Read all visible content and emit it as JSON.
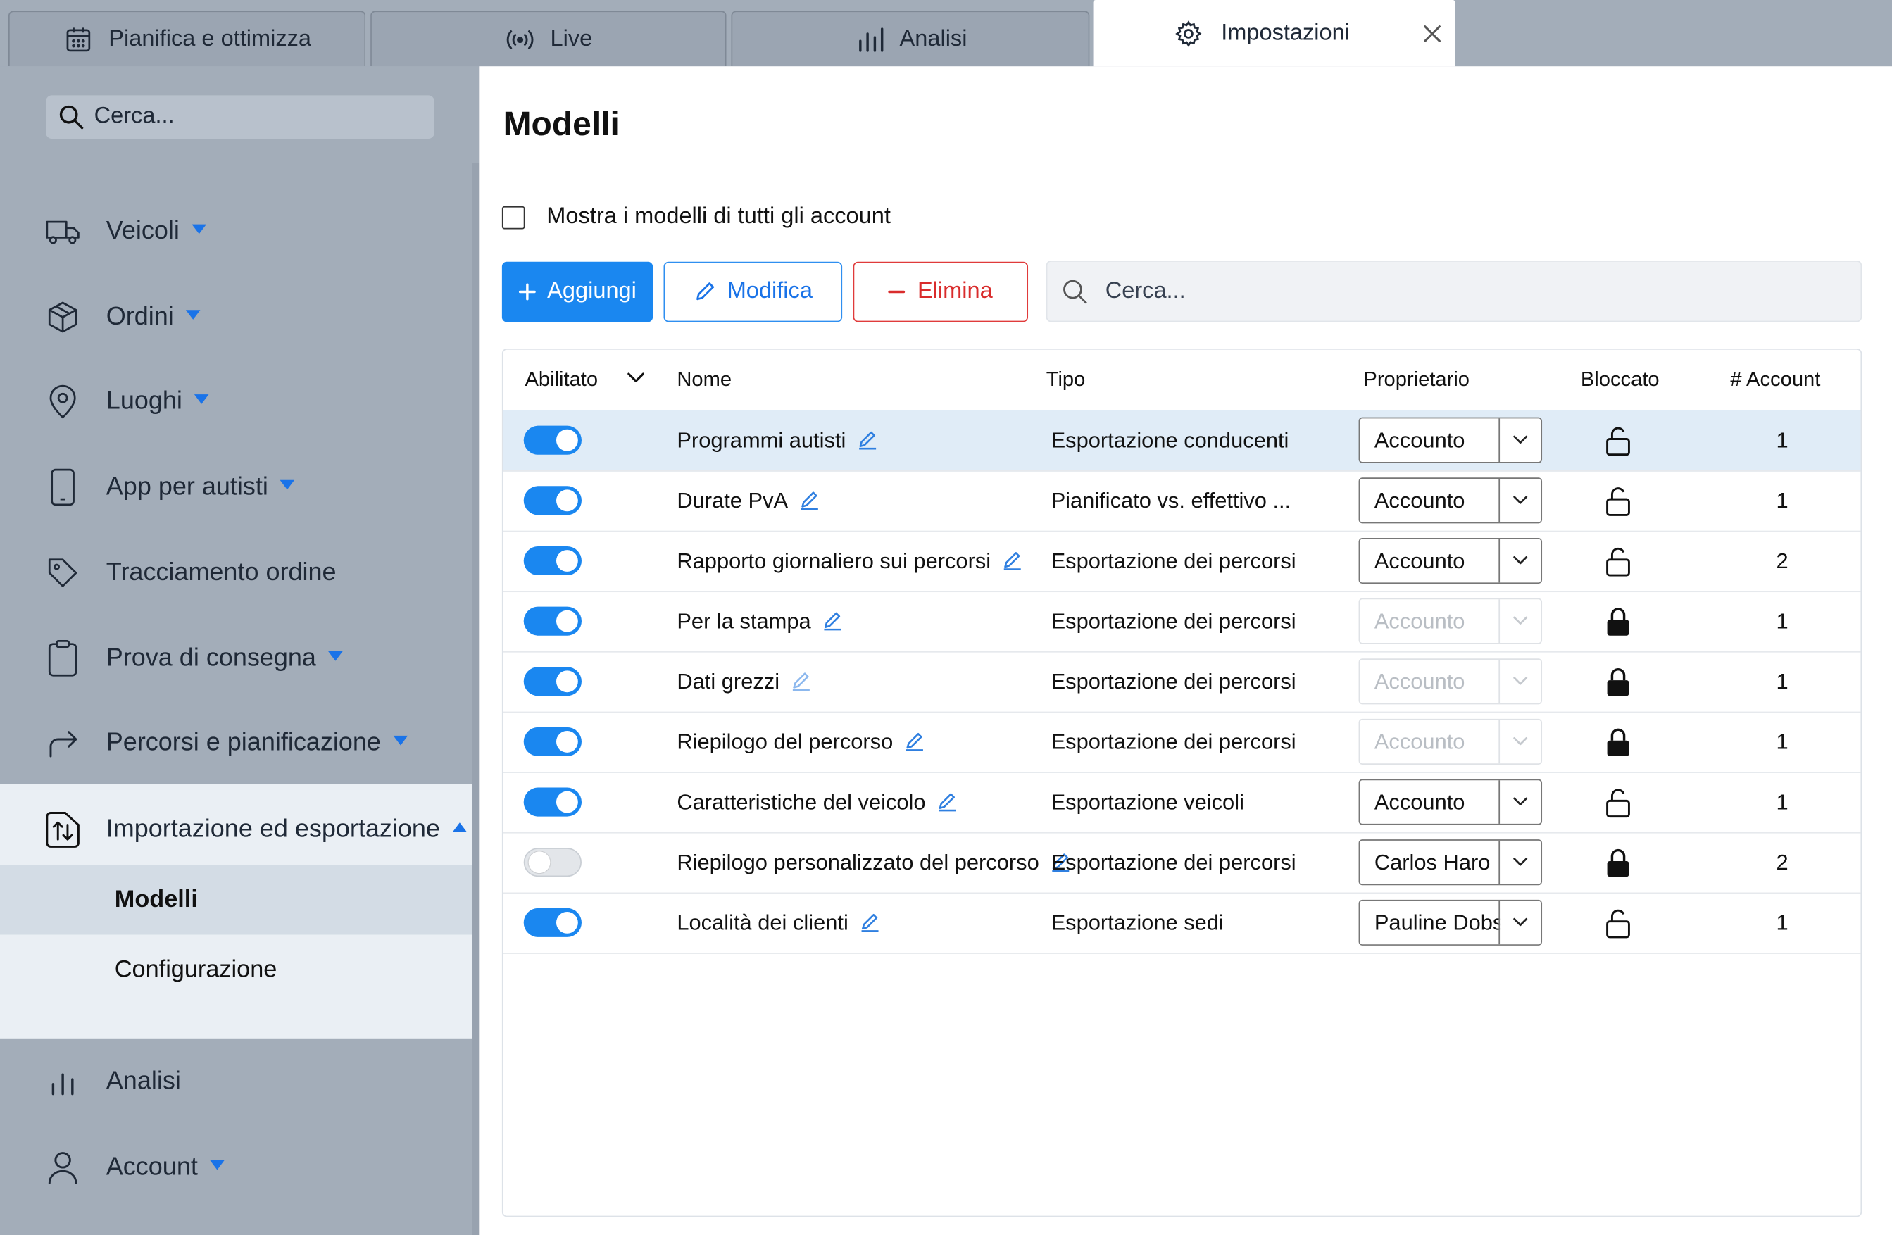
{
  "tabs": [
    {
      "label": "Pianifica e ottimizza",
      "icon": "calendar-icon",
      "active": false
    },
    {
      "label": "Live",
      "icon": "broadcast-icon",
      "active": false
    },
    {
      "label": "Analisi",
      "icon": "bar-chart-icon",
      "active": false
    },
    {
      "label": "Impostazioni",
      "icon": "gear-icon",
      "active": true
    }
  ],
  "sidebar": {
    "search_placeholder": "Cerca...",
    "items": [
      {
        "label": "Veicoli",
        "icon": "truck-icon"
      },
      {
        "label": "Ordini",
        "icon": "package-icon"
      },
      {
        "label": "Luoghi",
        "icon": "map-pin-icon"
      },
      {
        "label": "App per autisti",
        "icon": "phone-icon"
      },
      {
        "label": "Tracciamento ordine",
        "icon": "tag-icon"
      },
      {
        "label": "Prova di consegna",
        "icon": "clipboard-icon"
      },
      {
        "label": "Percorsi e pianificazione",
        "icon": "route-arrow-icon"
      },
      {
        "label": "Importazione ed esportazione",
        "icon": "import-export-icon"
      },
      {
        "label": "Analisi",
        "icon": "bar-chart-icon"
      },
      {
        "label": "Account",
        "icon": "user-icon"
      }
    ],
    "subitems": [
      {
        "label": "Modelli",
        "selected": true
      },
      {
        "label": "Configurazione",
        "selected": false
      }
    ]
  },
  "main": {
    "title": "Modelli",
    "show_all_label": "Mostra i modelli di tutti gli account",
    "buttons": {
      "add": "Aggiungi",
      "edit": "Modifica",
      "delete": "Elimina"
    },
    "search_placeholder": "Cerca...",
    "table": {
      "headers": {
        "enabled": "Abilitato",
        "name": "Nome",
        "type": "Tipo",
        "owner": "Proprietario",
        "locked": "Bloccato",
        "accounts": "# Account"
      },
      "rows": [
        {
          "enabled": true,
          "name": "Programmi autisti",
          "type": "Esportazione conducenti",
          "owner": "Accounto",
          "owner_disabled": false,
          "locked": false,
          "accounts": "1",
          "highlight": true
        },
        {
          "enabled": true,
          "name": "Durate PvA",
          "type": "Pianificato vs. effettivo ...",
          "owner": "Accounto",
          "owner_disabled": false,
          "locked": false,
          "accounts": "1"
        },
        {
          "enabled": true,
          "name": "Rapporto giornaliero sui percorsi",
          "type": "Esportazione dei percorsi",
          "owner": "Accounto",
          "owner_disabled": false,
          "locked": false,
          "accounts": "2"
        },
        {
          "enabled": true,
          "name": "Per la stampa",
          "type": "Esportazione dei percorsi",
          "owner": "Accounto",
          "owner_disabled": true,
          "locked": true,
          "accounts": "1"
        },
        {
          "enabled": true,
          "name": "Dati grezzi",
          "type": "Esportazione dei percorsi",
          "owner": "Accounto",
          "owner_disabled": true,
          "locked": true,
          "accounts": "1"
        },
        {
          "enabled": true,
          "name": "Riepilogo del percorso",
          "type": "Esportazione dei percorsi",
          "owner": "Accounto",
          "owner_disabled": true,
          "locked": true,
          "accounts": "1"
        },
        {
          "enabled": true,
          "name": "Caratteristiche del veicolo",
          "type": "Esportazione veicoli",
          "owner": "Accounto",
          "owner_disabled": false,
          "locked": false,
          "accounts": "1"
        },
        {
          "enabled": false,
          "name": "Riepilogo personalizzato del percorso",
          "type": "Esportazione dei percorsi",
          "owner": "Carlos Haro",
          "owner_disabled": false,
          "locked": true,
          "accounts": "2"
        },
        {
          "enabled": true,
          "name": "Località dei clienti",
          "type": "Esportazione sedi",
          "owner": "Pauline Dobso",
          "owner_disabled": false,
          "locked": false,
          "accounts": "1"
        }
      ]
    }
  },
  "colors": {
    "accent": "#1a87f0",
    "danger": "#d92c2c",
    "sidebar_bg": "#a3adb9",
    "row_highlight": "#e0ecf7"
  }
}
